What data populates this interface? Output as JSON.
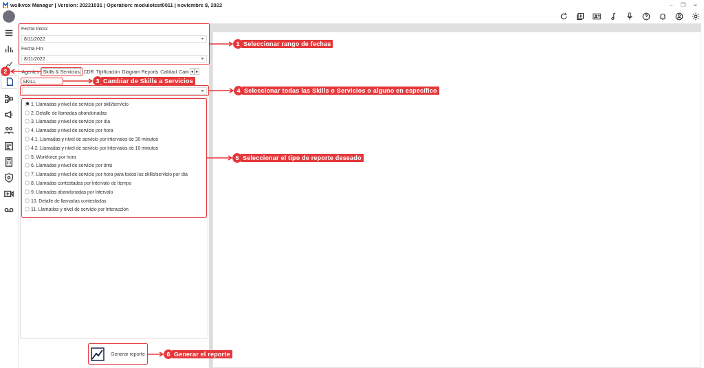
{
  "window": {
    "title": "wolkvox Manager  | Version: 20221031 |  Operation: modulotest0011 | noviembre 8, 2022",
    "controls": [
      "–",
      "❐",
      "×"
    ]
  },
  "sidebar": {
    "items": [
      {
        "selected": false
      },
      {
        "selected": false
      },
      {
        "selected": true
      },
      {
        "selected": false
      },
      {
        "selected": false
      },
      {
        "selected": false
      },
      {
        "selected": false
      },
      {
        "selected": false
      },
      {
        "selected": false
      },
      {
        "selected": false
      },
      {
        "selected": false
      }
    ]
  },
  "dates": [
    {
      "label": "Fecha Inicio:",
      "value": "8/11/2022"
    },
    {
      "label": "Fecha Fin:",
      "value": "8/11/2022"
    }
  ],
  "tabs": [
    {
      "label": "Agentes",
      "selected": false
    },
    {
      "label": "Skills & Servicios",
      "selected": true
    },
    {
      "label": "CDR",
      "selected": false
    },
    {
      "label": "Tipificación",
      "selected": false
    },
    {
      "label": "Diagram Reports",
      "selected": false
    },
    {
      "label": "Calidad",
      "selected": false
    },
    {
      "label": "Cam",
      "selected": false
    }
  ],
  "tab_scroll": [
    "◂",
    "▸"
  ],
  "skill_label": "SKILL",
  "reports": [
    {
      "label": "1. Llamadas y nivel de servicio por skill/servicio",
      "selected": true
    },
    {
      "label": "2. Detalle de llamadas abandonadas",
      "selected": false
    },
    {
      "label": "3. Llamadas y nivel de servicio por día",
      "selected": false
    },
    {
      "label": "4. Llamadas y nivel de servicio por hora",
      "selected": false
    },
    {
      "label": "4.1. Llamadas y nivel de servicio por intervalos de 30 minutos",
      "selected": false
    },
    {
      "label": "4.2. Llamadas y nivel de servicio por intervalos de 10 minutos",
      "selected": false
    },
    {
      "label": "5. Workforce por hora",
      "selected": false
    },
    {
      "label": "6. Llamadas y nivel de servicio por dnis",
      "selected": false
    },
    {
      "label": "7. Llamadas y nivel de servicio por hora para todos los skills/servicio por día",
      "selected": false
    },
    {
      "label": "8. Llamadas contestadas por intervalo de tiempo",
      "selected": false
    },
    {
      "label": "9. Llamadas abandonadas por intervalo",
      "selected": false
    },
    {
      "label": "10. Detalle de llamadas contestadas",
      "selected": false
    },
    {
      "label": "11. Llamadas y nivel de servicio por interacción",
      "selected": false
    }
  ],
  "generate_button": "Generar reporte",
  "annotations": [
    {
      "number": "1",
      "text": "Seleccionar rango de fechas"
    },
    {
      "number": "2"
    },
    {
      "number": "3",
      "text": "Cambiar de Skills a Servicios"
    },
    {
      "number": "4",
      "text": "Seleccionar todas las Skills o Servicios o alguno en específico"
    },
    {
      "number": "5",
      "text": "Seleccionar el tipo de reporte deseado"
    },
    {
      "number": "6",
      "text": "Generar el reporte"
    }
  ]
}
